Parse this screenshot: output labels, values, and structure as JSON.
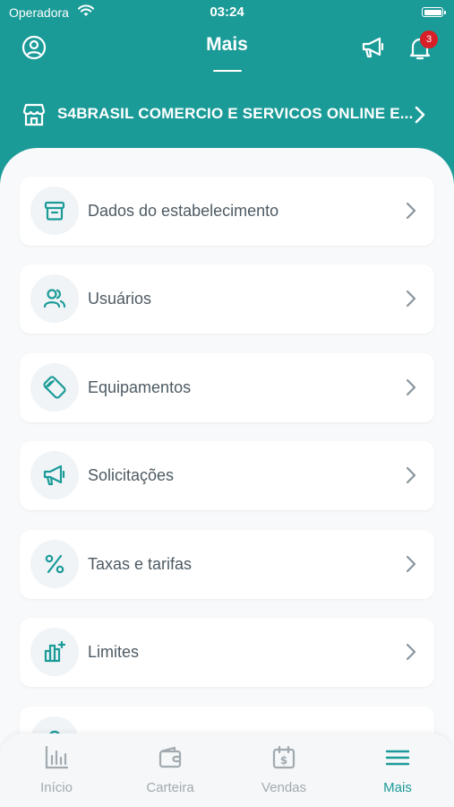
{
  "status": {
    "carrier": "Operadora",
    "time": "03:24"
  },
  "header": {
    "title": "Mais",
    "notification_count": "3",
    "store_name": "S4BRASIL COMERCIO E SERVICOS ONLINE E..."
  },
  "menu": [
    {
      "label": "Dados do estabelecimento",
      "icon": "archive-icon"
    },
    {
      "label": "Usuários",
      "icon": "users-icon"
    },
    {
      "label": "Equipamentos",
      "icon": "card-machine-icon"
    },
    {
      "label": "Solicitações",
      "icon": "megaphone-icon"
    },
    {
      "label": "Taxas e tarifas",
      "icon": "percent-icon"
    },
    {
      "label": "Limites",
      "icon": "bar-chart-plus-icon"
    }
  ],
  "tabs": [
    {
      "label": "Início",
      "icon": "chart-icon"
    },
    {
      "label": "Carteira",
      "icon": "wallet-icon"
    },
    {
      "label": "Vendas",
      "icon": "calendar-dollar-icon"
    },
    {
      "label": "Mais",
      "icon": "menu-icon",
      "active": true
    }
  ],
  "colors": {
    "primary": "#1b9b98",
    "badge": "#d61f26",
    "text": "#4d5a63",
    "inactive": "#a2aab0"
  }
}
